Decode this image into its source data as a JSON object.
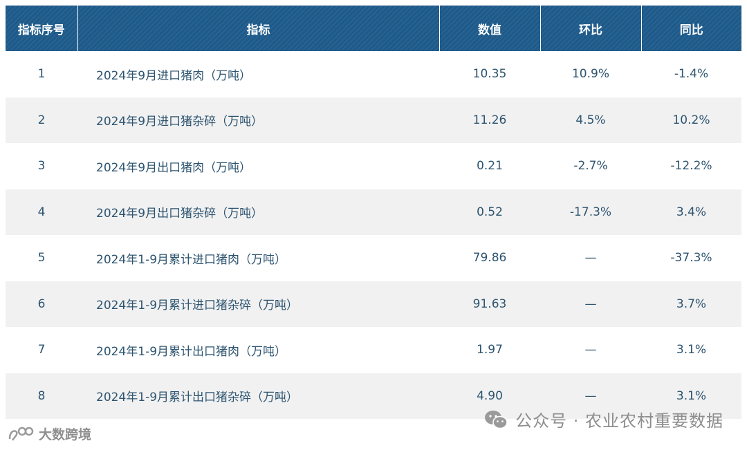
{
  "table": {
    "headers": [
      "指标序号",
      "指标",
      "数值",
      "环比",
      "同比"
    ],
    "rows": [
      {
        "no": "1",
        "indicator": "2024年9月进口猪肉（万吨）",
        "value": "10.35",
        "mom": "10.9%",
        "yoy": "-1.4%"
      },
      {
        "no": "2",
        "indicator": "2024年9月进口猪杂碎（万吨）",
        "value": "11.26",
        "mom": "4.5%",
        "yoy": "10.2%"
      },
      {
        "no": "3",
        "indicator": "2024年9月出口猪肉（万吨）",
        "value": "0.21",
        "mom": "-2.7%",
        "yoy": "-12.2%"
      },
      {
        "no": "4",
        "indicator": "2024年9月出口猪杂碎（万吨）",
        "value": "0.52",
        "mom": "-17.3%",
        "yoy": "3.4%"
      },
      {
        "no": "5",
        "indicator": "2024年1-9月累计进口猪肉（万吨）",
        "value": "79.86",
        "mom": "—",
        "yoy": "-37.3%"
      },
      {
        "no": "6",
        "indicator": "2024年1-9月累计进口猪杂碎（万吨）",
        "value": "91.63",
        "mom": "—",
        "yoy": "3.7%"
      },
      {
        "no": "7",
        "indicator": "2024年1-9月累计出口猪肉（万吨）",
        "value": "1.97",
        "mom": "—",
        "yoy": "3.1%"
      },
      {
        "no": "8",
        "indicator": "2024年1-9月累计出口猪杂碎（万吨）",
        "value": "4.90",
        "mom": "—",
        "yoy": "3.1%"
      }
    ]
  },
  "watermark": {
    "right_text": "公众号 · 农业农村重要数据",
    "right_icon": "wechat-icon",
    "left_text": "大数跨境",
    "left_icon": "brand-logo"
  },
  "colors": {
    "header_bg": "#1d5a8a",
    "body_text": "#2d5470",
    "stripe_bg": "#f1f1f1",
    "watermark": "#8d8d8d"
  }
}
